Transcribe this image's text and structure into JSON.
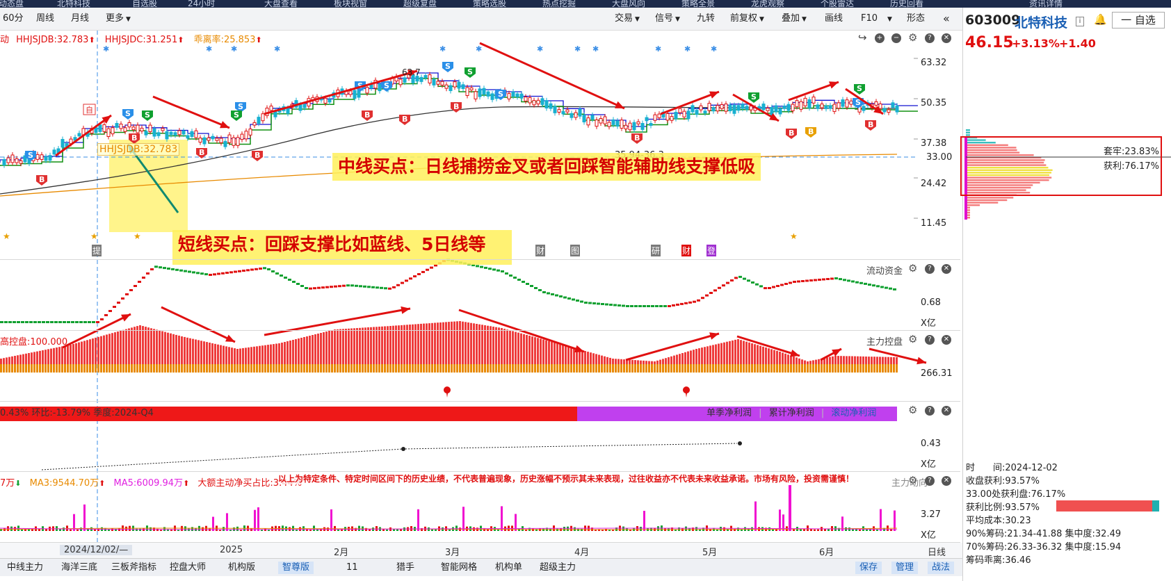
{
  "topnav": [
    "动态盘",
    "北特科技",
    "自选股",
    "24小时",
    "大盘查看",
    "板块视窗",
    "超级复盘",
    "策略选股",
    "热点挖掘",
    "大盘风向",
    "策略全景",
    "龙虎观察",
    "个股雷达",
    "历史回看",
    "资讯详情"
  ],
  "toolbar": {
    "left_buttons": [
      "60分",
      "周线",
      "月线",
      "更多"
    ],
    "right_buttons": [
      "交易",
      "信号",
      "九转",
      "前复权",
      "叠加",
      "画线",
      "F10",
      "形态"
    ],
    "collapse_icon": "double-chevron-left-icon"
  },
  "main_legend": {
    "prefix": "动",
    "items": [
      {
        "text": "HHJSJDB:32.783",
        "color": "#e01010"
      },
      {
        "text": "HHJSJDC:31.251",
        "color": "#e01010"
      },
      {
        "text": "乖离率:25.853",
        "color": "#e88a00"
      }
    ]
  },
  "price_axis": [
    "63.32",
    "50.35",
    "37.38",
    "33.00",
    "24.42",
    "11.45"
  ],
  "price_tags": {
    "hh_label": "HHJSJDB:32.783",
    "range_label": "35.94-36.3",
    "high_label": "63.7"
  },
  "notes": {
    "mid": "中线买点：日线捕捞金叉或者回踩智能辅助线支撑低吸",
    "short": "短线买点：回踩支撑比如蓝线、5日线等"
  },
  "event_markers": [
    "提",
    "财",
    "图",
    "研",
    "财",
    "登"
  ],
  "panel_flow": {
    "title": "流动资金",
    "axis": "0.68",
    "unit": "X亿"
  },
  "panel_control": {
    "title": "主力控盘",
    "legend": "高控盘:100.000",
    "axis": "266.31"
  },
  "panel_profit": {
    "legend_left": "0.43%  环比:-13.79%  季度:2024-Q4",
    "tabs": [
      "单季净利润",
      "累计净利润",
      "滚动净利润"
    ],
    "axis": "0.43",
    "unit": "X亿"
  },
  "panel_volume": {
    "items": [
      {
        "text": "7万",
        "color": "#e01010"
      },
      {
        "text": "MA3:9544.70万",
        "color": "#e88a00"
      },
      {
        "text": "MA5:6009.94万",
        "color": "#e020e0"
      },
      {
        "text": "大额主动净买占比:3.44%",
        "color": "#e01010"
      }
    ],
    "disclaimer": "以上为特定条件、特定时间区间下的历史业绩，不代表普遍现象，历史涨幅不预示其未来表现，过往收益亦不代表未来收益承诺。市场有风险，投资需谨慎！",
    "title_tail": "主力动向",
    "axis": "3.27",
    "unit": "X亿"
  },
  "xaxis": {
    "labels": [
      "2024/12/02/—",
      "2025",
      "2月",
      "3月",
      "4月",
      "5月",
      "6月"
    ],
    "period": "日线"
  },
  "bottom_tabs": [
    "中线主力",
    "海洋三底",
    "三板斧指标",
    "控盘大师",
    "机构版",
    "智尊版",
    "11",
    "猎手",
    "智能网格",
    "机构单",
    "超级主力"
  ],
  "bottom_actions": [
    "保存",
    "管理",
    "战法"
  ],
  "side": {
    "code": "603009",
    "name": "北特科技",
    "info_icon": "i",
    "bell_icon": "bell-icon",
    "watch_label": "一 自选",
    "price": "46.15",
    "change_pct": "+3.13%",
    "change_abs": "+1.40",
    "trapped": "套牢:23.83%",
    "profit": "获利:76.17%",
    "stats": [
      "时　　间:2024-12-02",
      "收盘获利:93.57%",
      "33.00处获利盘:76.17%",
      "获利比例:93.57%",
      "平均成本:30.23",
      "90%筹码:21.34-41.88  集中度:32.49",
      "70%筹码:26.33-36.32  集中度:15.94",
      "筹码乖离:36.46"
    ]
  },
  "colors": {
    "up": "#e01010",
    "down": "#10a030",
    "accent": "#1a5fb4",
    "ma_blue": "#1010d0",
    "ma_green": "#109010",
    "ma_orange": "#e88a00"
  }
}
